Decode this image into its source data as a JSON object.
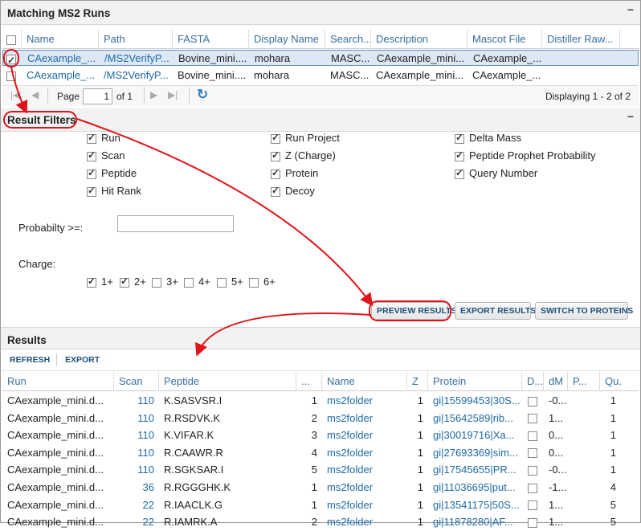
{
  "ms2runs": {
    "title": "Matching MS2 Runs",
    "columns": [
      "Name",
      "Path",
      "FASTA",
      "Display Name",
      "Search...",
      "Description",
      "Mascot File",
      "Distiller Raw..."
    ],
    "rows": [
      [
        "CAexample_...",
        "/MS2VerifyP...",
        "Bovine_mini....",
        "mohara",
        "MASC...",
        "CAexample_mini...",
        "CAexample_..."
      ],
      [
        "CAexample_...",
        "/MS2VerifyP...",
        "Bovine_mini....",
        "mohara",
        "MASC...",
        "CAexample_mini...",
        "CAexample_..."
      ]
    ],
    "pager": {
      "page_label": "Page",
      "page_value": "1",
      "of_label": "of 1",
      "displaying": "Displaying 1 - 2 of 2"
    }
  },
  "filters": {
    "title": "Result Filters",
    "checkboxes": [
      "Run",
      "Scan",
      "Peptide",
      "Hit Rank",
      "Run Project",
      "Z (Charge)",
      "Protein",
      "Decoy",
      "Delta Mass",
      "Peptide Prophet Probability",
      "Query Number"
    ],
    "probability_label": "Probabilty >=:",
    "probability_value": "",
    "charge_label": "Charge:",
    "charges": [
      "1+",
      "2+",
      "3+",
      "4+",
      "5+",
      "6+"
    ],
    "buttons": {
      "preview": "PREVIEW RESULTS",
      "export": "EXPORT RESULTS",
      "switch": "SWITCH TO PROTEINS"
    }
  },
  "results": {
    "title": "Results",
    "toolbar": {
      "refresh": "REFRESH",
      "export": "EXPORT"
    },
    "columns": [
      "Run",
      "Scan",
      "Peptide",
      "...",
      "Name",
      "Z",
      "Protein",
      "D...",
      "dM",
      "P...",
      "Qu..."
    ],
    "rows": [
      [
        "CAexample_mini.d...",
        "110",
        "K.SASVSR.I",
        "1",
        "ms2folder",
        "1",
        "gi|15599453|30S...",
        "-0...",
        "",
        "1"
      ],
      [
        "CAexample_mini.d...",
        "110",
        "R.RSDVK.K",
        "2",
        "ms2folder",
        "1",
        "gi|15642589|rib...",
        "1...",
        "",
        "1"
      ],
      [
        "CAexample_mini.d...",
        "110",
        "K.VIFAR.K",
        "3",
        "ms2folder",
        "1",
        "gi|30019716|Xa...",
        "0...",
        "",
        "1"
      ],
      [
        "CAexample_mini.d...",
        "110",
        "R.CAAWR.R",
        "4",
        "ms2folder",
        "1",
        "gi|27693369|sim...",
        "0...",
        "",
        "1"
      ],
      [
        "CAexample_mini.d...",
        "110",
        "R.SGKSAR.I",
        "5",
        "ms2folder",
        "1",
        "gi|17545655|PR...",
        "-0...",
        "",
        "1"
      ],
      [
        "CAexample_mini.d...",
        "36",
        "R.RGGGHK.K",
        "1",
        "ms2folder",
        "1",
        "gi|11036695|put...",
        "-1...",
        "",
        "4"
      ],
      [
        "CAexample_mini.d...",
        "22",
        "R.IAACLK.G",
        "1",
        "ms2folder",
        "1",
        "gi|13541175|50S...",
        "1...",
        "",
        "5"
      ],
      [
        "CAexample_mini.d...",
        "22",
        "R.IAMRK.A",
        "2",
        "ms2folder",
        "1",
        "gi|11878280|AF...",
        "1...",
        "",
        "5"
      ]
    ]
  }
}
